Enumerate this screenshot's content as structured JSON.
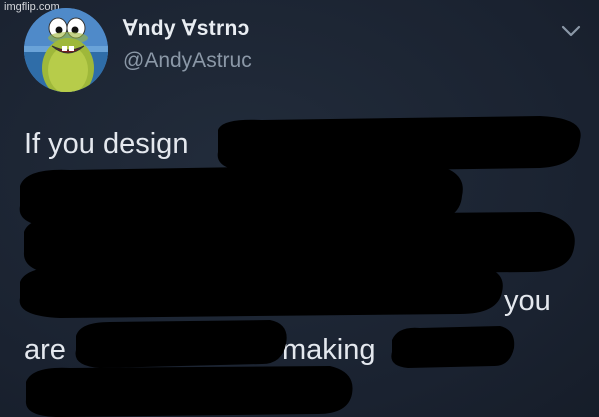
{
  "watermark": "imgflip.com",
  "author": {
    "display_name": "∀ndy ∀strnɔ",
    "handle": "@AndyAstruc",
    "avatar_icon": "cartoon-fish-avatar"
  },
  "menu_icon": "chevron-down-icon",
  "tweet": {
    "line1_start": "If you design",
    "line4_end": "you",
    "line5_start": "are",
    "line5_middle": "making",
    "redacted": true
  },
  "colors": {
    "background": "#1c2533",
    "text": "#e4e8ee",
    "handle": "#8b98a7",
    "redaction": "#000000"
  }
}
